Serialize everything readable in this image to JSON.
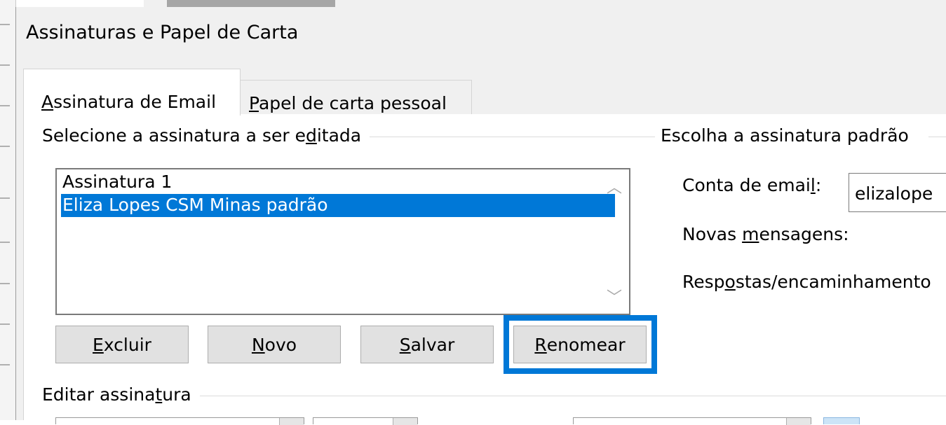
{
  "dialog": {
    "title": "Assinaturas e Papel de Carta"
  },
  "tabs": [
    {
      "pre": "",
      "key": "A",
      "post": "ssinatura de Email",
      "active": true
    },
    {
      "pre": "",
      "key": "P",
      "post": "apel de carta pessoal",
      "active": false
    }
  ],
  "select_group": {
    "pre": "Selecione a assinatura a ser e",
    "key": "d",
    "post": "itada"
  },
  "signatures": [
    {
      "label": "Assinatura 1",
      "selected": false
    },
    {
      "label": "Eliza Lopes CSM Minas padrão",
      "selected": true
    }
  ],
  "buttons": {
    "delete": {
      "key": "E",
      "post": "xcluir"
    },
    "new": {
      "key": "N",
      "post": "ovo"
    },
    "save": {
      "key": "S",
      "post": "alvar"
    },
    "rename": {
      "key": "R",
      "post": "enomear"
    }
  },
  "defaults_group": {
    "title": "Escolha a assinatura padrão",
    "account_label": {
      "pre": "Conta de emai",
      "key": "l",
      "post": ":"
    },
    "account_value": "elizalope",
    "new_messages_label": {
      "pre": "Novas ",
      "key": "m",
      "post": "ensagens:"
    },
    "replies_label": {
      "pre": "Resp",
      "key": "o",
      "post": "stas/encaminhamento"
    }
  },
  "edit_group": {
    "pre": "Editar assina",
    "key": "t",
    "post": "ura"
  },
  "icons": {
    "scroll_up": "chevron-up-icon",
    "scroll_down": "chevron-down-icon"
  },
  "colors": {
    "accent": "#0078d7",
    "selection": "#0078d7",
    "dialog_bg": "#f0f0f0"
  }
}
